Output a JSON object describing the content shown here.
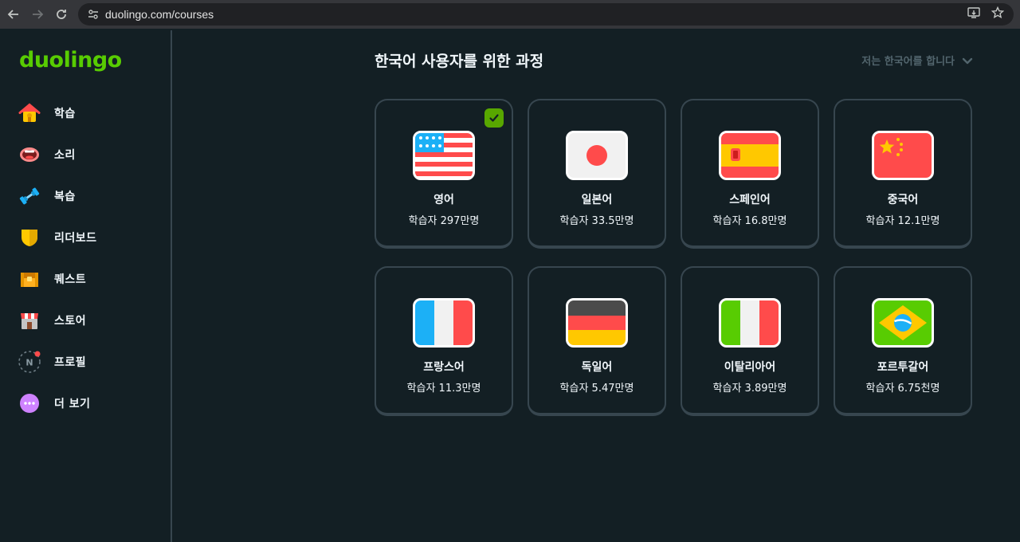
{
  "browser": {
    "url": "duolingo.com/courses"
  },
  "brand": {
    "logo_text": "duolingo",
    "accent": "#58cc02"
  },
  "sidebar": {
    "items": [
      {
        "label": "학습",
        "icon": "home-icon"
      },
      {
        "label": "소리",
        "icon": "mouth-icon"
      },
      {
        "label": "복습",
        "icon": "dumbbell-icon"
      },
      {
        "label": "리더보드",
        "icon": "shield-icon"
      },
      {
        "label": "퀘스트",
        "icon": "chest-icon"
      },
      {
        "label": "스토어",
        "icon": "shop-icon"
      },
      {
        "label": "프로필",
        "icon": "profile-icon",
        "avatar_letter": "N"
      },
      {
        "label": "더 보기",
        "icon": "more-icon"
      }
    ]
  },
  "main": {
    "title": "한국어 사용자를 위한 과정",
    "language_select": "저는 한국어를 합니다"
  },
  "courses": [
    {
      "name": "영어",
      "learners": "학습자 297만명",
      "flag": "us-flag-icon",
      "selected": true
    },
    {
      "name": "일본어",
      "learners": "학습자 33.5만명",
      "flag": "japan-flag-icon"
    },
    {
      "name": "스페인어",
      "learners": "학습자 16.8만명",
      "flag": "spain-flag-icon"
    },
    {
      "name": "중국어",
      "learners": "학습자 12.1만명",
      "flag": "china-flag-icon"
    },
    {
      "name": "프랑스어",
      "learners": "학습자 11.3만명",
      "flag": "france-flag-icon"
    },
    {
      "name": "독일어",
      "learners": "학습자 5.47만명",
      "flag": "germany-flag-icon"
    },
    {
      "name": "이탈리아어",
      "learners": "학습자 3.89만명",
      "flag": "italy-flag-icon"
    },
    {
      "name": "포르투갈어",
      "learners": "학습자 6.75천명",
      "flag": "brazil-flag-icon"
    }
  ]
}
